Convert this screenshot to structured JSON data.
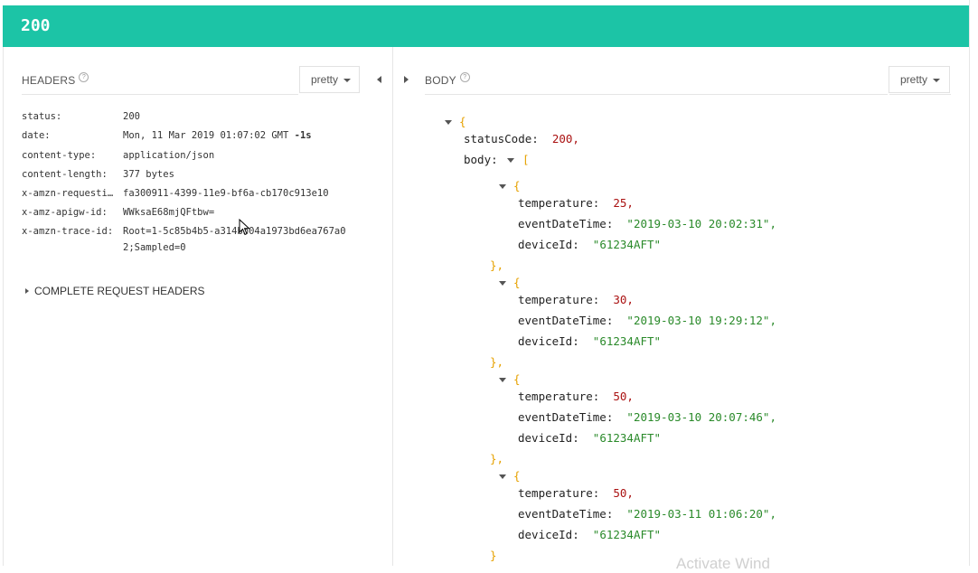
{
  "status": {
    "code": "200"
  },
  "headers_panel": {
    "title": "HEADERS",
    "help_glyph": "?",
    "format_label": "pretty",
    "rows": [
      {
        "key": "status:",
        "value": "200",
        "suffix": ""
      },
      {
        "key": "date:",
        "value": "Mon, 11 Mar 2019 01:07:02 GMT ",
        "suffix": "-1s"
      },
      {
        "key": "content-type:",
        "value": "application/json",
        "suffix": ""
      },
      {
        "key": "content-length:",
        "value": "377 bytes",
        "suffix": ""
      },
      {
        "key": "x-amzn-requesti…",
        "value": "fa300911-4399-11e9-bf6a-cb170c913e10",
        "suffix": ""
      },
      {
        "key": "x-amz-apigw-id:",
        "value": "WWksaE68mjQFtbw=",
        "suffix": ""
      },
      {
        "key": "x-amzn-trace-id:",
        "value": "Root=1-5c85b4b5-a314bb04a1973bd6ea767a0",
        "value_line2": "2;Sampled=0",
        "suffix": ""
      }
    ],
    "complete_request_headers_label": "COMPLETE REQUEST HEADERS"
  },
  "body_panel": {
    "title": "BODY",
    "help_glyph": "?",
    "format_label": "pretty",
    "json": {
      "open_brace": "{",
      "status_code_key": "statusCode:",
      "status_code_value": "200,",
      "body_key": "body:",
      "open_bracket": "[",
      "items": [
        {
          "temperature": "25,",
          "eventDateTime": "\"2019-03-10 20:02:31\",",
          "deviceId": "\"61234AFT\"",
          "close": "},"
        },
        {
          "temperature": "30,",
          "eventDateTime": "\"2019-03-10 19:29:12\",",
          "deviceId": "\"61234AFT\"",
          "close": "},"
        },
        {
          "temperature": "50,",
          "eventDateTime": "\"2019-03-10 20:07:46\",",
          "deviceId": "\"61234AFT\"",
          "close": "},"
        },
        {
          "temperature": "50,",
          "eventDateTime": "\"2019-03-11 01:06:20\",",
          "deviceId": "\"61234AFT\"",
          "close": "}"
        }
      ],
      "labels": {
        "temperature": "temperature:",
        "eventDateTime": "eventDateTime:",
        "deviceId": "deviceId:"
      }
    }
  },
  "watermark": "Activate Wind",
  "colors": {
    "status_bar": "#1cc4a6",
    "number": "#aa1111",
    "string": "#2a8a2a",
    "brace": "#e6a100"
  }
}
